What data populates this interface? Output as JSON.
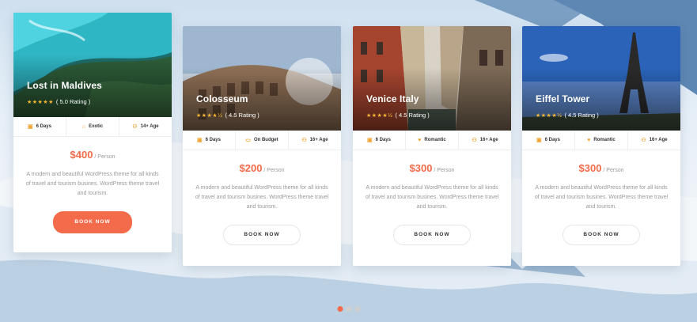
{
  "cards": [
    {
      "title": "Lost in Maldives",
      "rating": "( 5.0 Rating )",
      "stars": "★★★★★",
      "days": "6 Days",
      "tag": "Exotic",
      "age": "14+ Age",
      "price": "$400",
      "per": "/ Person",
      "desc": "A modern and beautiful WordPress theme for all kinds of travel and tourism busines. WordPress theme travel and tourism.",
      "button": "BOOK NOW"
    },
    {
      "title": "Colosseum",
      "rating": "( 4.5 Rating )",
      "stars": "★★★★½",
      "days": "6 Days",
      "tag": "On Budget",
      "age": "16+ Age",
      "price": "$200",
      "per": "/ Person",
      "desc": "A modern and beautiful WordPress theme for all kinds of travel and tourism busines. WordPress theme travel and tourism.",
      "button": "BOOK NOW"
    },
    {
      "title": "Venice Italy",
      "rating": "( 4.5 Rating )",
      "stars": "★★★★½",
      "days": "6 Days",
      "tag": "Romantic",
      "age": "16+ Age",
      "price": "$300",
      "per": "/ Person",
      "desc": "A modern and beautiful WordPress theme for all kinds of travel and tourism busines. WordPress theme travel and tourism.",
      "button": "BOOK NOW"
    },
    {
      "title": "Eiffel Tower",
      "rating": "( 4.5 Rating )",
      "stars": "★★★★½",
      "days": "6 Days",
      "tag": "Romantic",
      "age": "16+ Age",
      "price": "$300",
      "per": "/ Person",
      "desc": "A modern and beautiful WordPress theme for all kinds of travel and tourism busines. WordPress theme travel and tourism.",
      "button": "BOOK NOW"
    }
  ],
  "icons": {
    "days": "calendar-icon",
    "exotic": "house-icon",
    "budget": "wallet-icon",
    "romantic": "heart-icon",
    "age": "people-icon"
  },
  "colors": {
    "accent": "#f36b4a",
    "star": "#f7b733",
    "icon": "#f0a434"
  },
  "carousel": {
    "pages": 3,
    "active": 1
  }
}
